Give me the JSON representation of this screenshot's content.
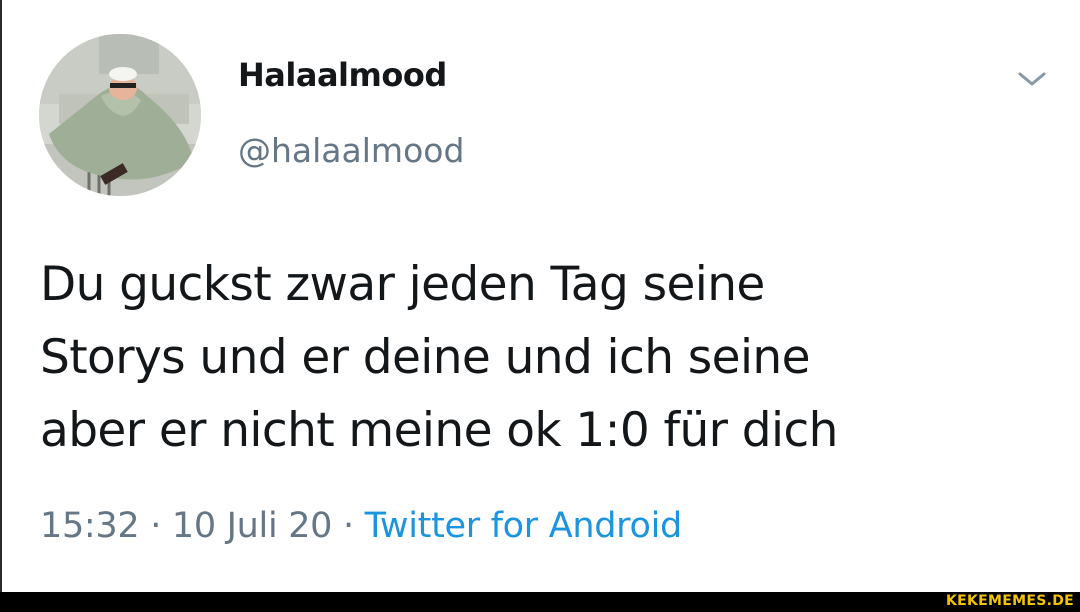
{
  "tweet": {
    "display_name": "Halaalmood",
    "handle": "@halaalmood",
    "text_lines": [
      "Du guckst zwar jeden Tag seine",
      "Storys und er deine und ich seine",
      "aber er nicht meine ok 1:0 für dich"
    ],
    "time": "15:32",
    "separator": "·",
    "date": "10 Juli 20",
    "source": "Twitter for Android",
    "menu_icon": "chevron-down-icon",
    "avatar_icon": "profile-avatar-image"
  },
  "footer": {
    "watermark": "KEKEMEMES.DE"
  },
  "colors": {
    "text_primary": "#14171a",
    "text_secondary": "#657786",
    "link": "#1b95e0",
    "watermark": "#f5c400"
  }
}
